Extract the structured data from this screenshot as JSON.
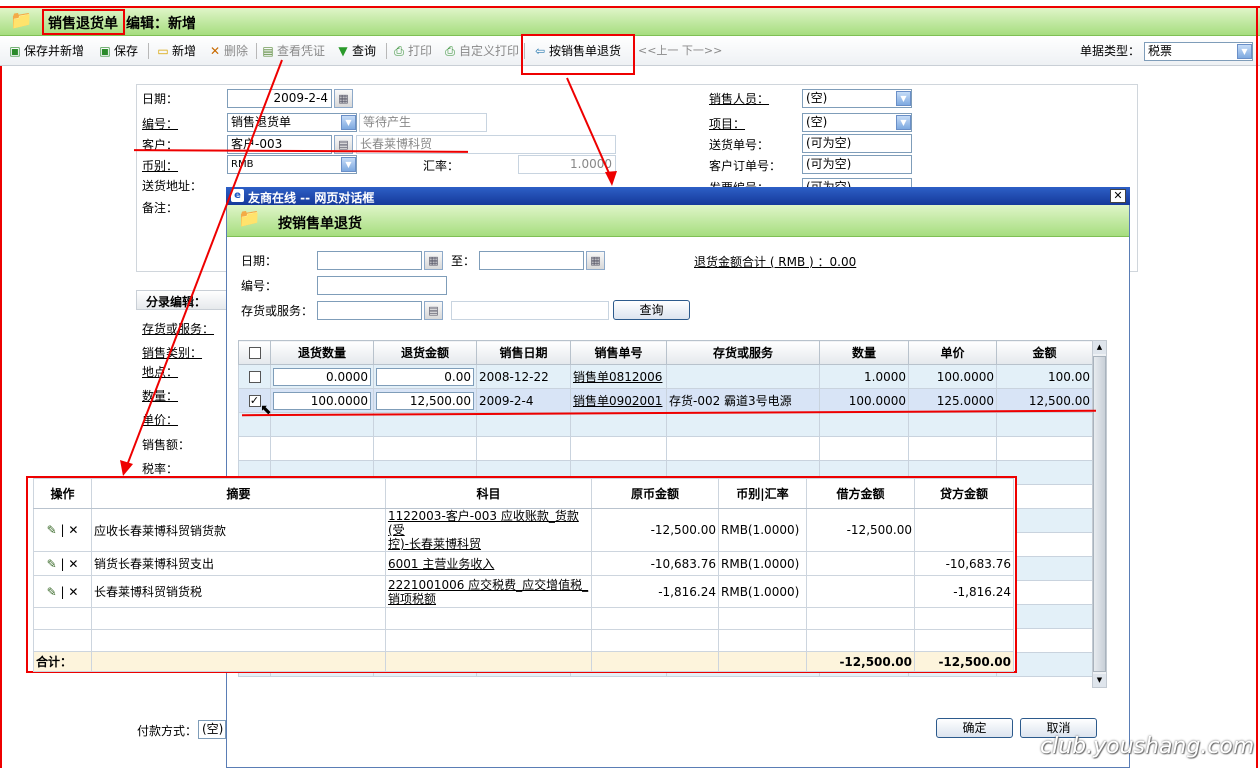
{
  "window": {
    "title_main": "销售退货单",
    "title_rest": "编辑：新增",
    "watermark": "club.youshang.com"
  },
  "toolbar": {
    "save_new": "保存并新增",
    "save": "保存",
    "add": "新增",
    "delete": "删除",
    "view_voucher": "查看凭证",
    "query": "查询",
    "print": "打印",
    "custom_print": "自定义打印",
    "return_by_order": "按销售单退货",
    "prev_next": "<<上一  下一>>",
    "doc_type_label": "单据类型：",
    "doc_type_value": "税票"
  },
  "form": {
    "date_label": "日期：",
    "date_value": "2009-2-4",
    "number_label": "编号：",
    "number_value": "销售退货单",
    "number_hint": "等待产生",
    "customer_label": "客户：",
    "customer_code": "客户-003",
    "customer_name": "长春莱博科贸",
    "currency_label": "币别：",
    "currency_value": "RMB",
    "rate_label": "汇率：",
    "rate_value": "1.0000",
    "address_label": "送货地址：",
    "remark_label": "备注：",
    "salesperson_label": "销售人员：",
    "salesperson_value": "(空)",
    "project_label": "项目：",
    "project_value": "(空)",
    "delivery_no_label": "送货单号：",
    "delivery_no_value": "(可为空)",
    "customer_order_label": "客户订单号：",
    "customer_order_value": "(可为空)",
    "invoice_no_label": "发票编号：",
    "invoice_no_value": "(可为空)"
  },
  "left_panel": {
    "header": "分录编辑：",
    "inventory": "存货或服务：",
    "sales_category": "销售类别：",
    "location": "地点：",
    "quantity": "数量：",
    "unit_price": "单价：",
    "sales_amount": "销售额：",
    "tax_rate": "税率：",
    "payment_label": "付款方式：",
    "payment_value": "(空)"
  },
  "dialog": {
    "window_title": "友商在线 -- 网页对话框",
    "title": "按销售单退货",
    "date_label": "日期：",
    "to_label": "至：",
    "number_label": "编号：",
    "inventory_label": "存货或服务：",
    "query_btn": "查询",
    "total_label": "退货金额合计 ( RMB ) ：0.00",
    "confirm_btn": "确定",
    "cancel_btn": "取消",
    "columns": [
      "退货数量",
      "退货金额",
      "销售日期",
      "销售单号",
      "存货或服务",
      "数量",
      "单价",
      "金额"
    ],
    "rows": [
      {
        "checked": false,
        "return_qty": "0.0000",
        "return_amount": "0.00",
        "sale_date": "2008-12-22",
        "order_no": "销售单0812006",
        "item": "",
        "qty": "1.0000",
        "price": "100.0000",
        "amount": "100.00"
      },
      {
        "checked": true,
        "return_qty": "100.0000",
        "return_amount": "12,500.00",
        "sale_date": "2009-2-4",
        "order_no": "销售单0902001",
        "item": "存货-002 霸道3号电源",
        "qty": "100.0000",
        "price": "125.0000",
        "amount": "12,500.00"
      }
    ]
  },
  "voucher": {
    "columns": [
      "操作",
      "摘要",
      "科目",
      "原币金额",
      "币别|汇率",
      "借方金额",
      "贷方金额"
    ],
    "rows": [
      {
        "summary": "应收长春莱博科贸销货款",
        "account_line1": "1122003-客户-003 应收账款_货款(受",
        "account_line2": "控)-长春莱博科贸",
        "orig_amount": "-12,500.00",
        "currency": "RMB(1.0000)",
        "debit": "-12,500.00",
        "credit": ""
      },
      {
        "summary": "销货长春莱博科贸支出",
        "account_line1": "6001 主营业务收入",
        "account_line2": "",
        "orig_amount": "-10,683.76",
        "currency": "RMB(1.0000)",
        "debit": "",
        "credit": "-10,683.76"
      },
      {
        "summary": "长春莱博科贸销货税",
        "account_line1": "2221001006 应交税费_应交增值税_",
        "account_line2": "销项税额",
        "orig_amount": "-1,816.24",
        "currency": "RMB(1.0000)",
        "debit": "",
        "credit": "-1,816.24"
      }
    ],
    "total_label": "合计：",
    "total_debit": "-12,500.00",
    "total_credit": "-12,500.00"
  }
}
